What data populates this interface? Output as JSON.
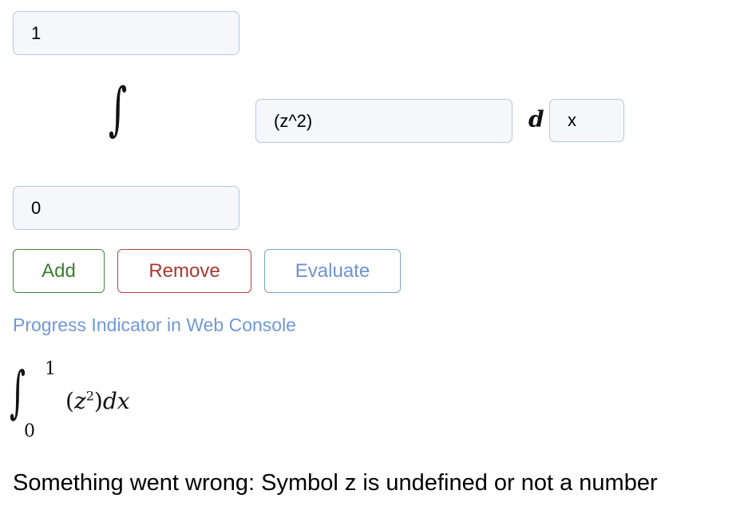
{
  "inputs": {
    "upper_limit": "1",
    "lower_limit": "0",
    "integrand": "(z^2)",
    "variable": "x"
  },
  "labels": {
    "integral_symbol": "∫",
    "differential": "d"
  },
  "buttons": {
    "add": "Add",
    "remove": "Remove",
    "evaluate": "Evaluate"
  },
  "progress_link": "Progress Indicator in Web Console",
  "rendered_formula": {
    "upper": "1",
    "lower": "0",
    "integrand_base": "z",
    "integrand_exponent": "2",
    "differential": "dx"
  },
  "error_message": "Something went wrong: Symbol z is undefined or not a number",
  "colors": {
    "add": "#3a7f2f",
    "remove": "#a8392e",
    "evaluate": "#6d93d3",
    "link": "#6f98d8",
    "field_border": "#b7c7df"
  }
}
